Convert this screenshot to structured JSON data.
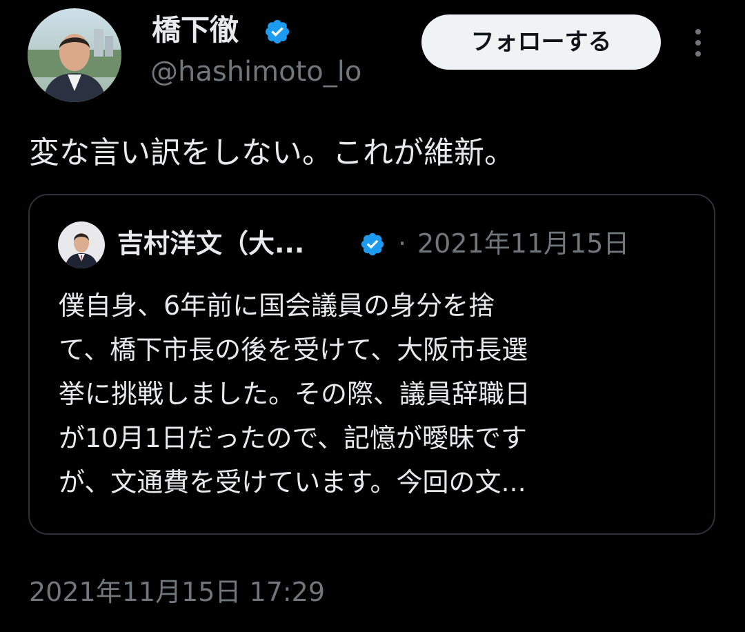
{
  "author": {
    "display_name": "橋下徹",
    "handle": "@hashimoto_lo",
    "verified": true,
    "avatar_icon": "person-avatar"
  },
  "follow_button": {
    "label": "フォローする"
  },
  "more_icon": "more-vertical-icon",
  "tweet": {
    "text": "変な言い訳をしない。これが維新。",
    "timestamp": "2021年11月15日 17:29"
  },
  "quoted_tweet": {
    "author_name": "吉村洋文（大...",
    "verified": true,
    "separator": "·",
    "date": "2021年11月15日",
    "text_lines": [
      "僕自身、6年前に国会議員の身分を捨",
      "て、橋下市長の後を受けて、大阪市長選",
      "挙に挑戦しました。その際、議員辞職日",
      "が10月1日だったので、記憶が曖昧です",
      "が、文通費を受けています。今回の文..."
    ]
  },
  "colors": {
    "background": "#000000",
    "primary_text": "#e7e9ea",
    "secondary_text": "#71767b",
    "verified_blue": "#1d9bf0",
    "card_border": "#2f3336",
    "follow_button_bg": "#eff3f4",
    "follow_button_text": "#0f1419"
  }
}
